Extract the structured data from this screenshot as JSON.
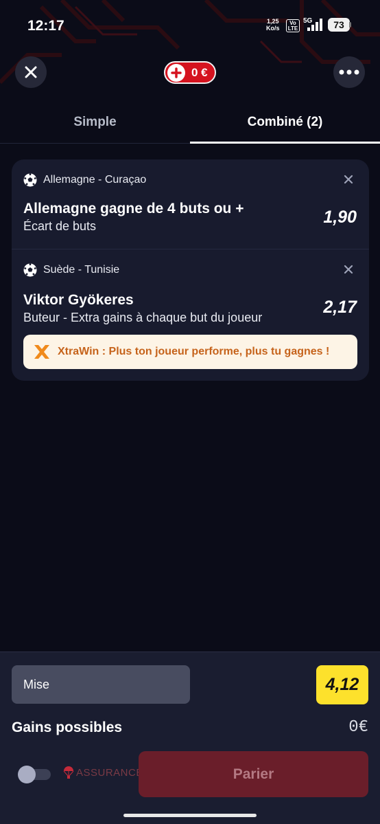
{
  "status_bar": {
    "time": "12:17",
    "net_speed_value": "1,25",
    "net_speed_unit": "Ko/s",
    "volte_top": "Vo",
    "volte_bottom": "LTE",
    "network": "5G",
    "battery": "73"
  },
  "header": {
    "close_icon": "close-icon",
    "balance": "0 €",
    "more_icon": "more-dots-icon"
  },
  "tabs": [
    {
      "label": "Simple",
      "active": false
    },
    {
      "label": "Combiné (2)",
      "active": true
    }
  ],
  "selections": [
    {
      "match": "Allemagne - Curaçao",
      "sport_icon": "soccer-ball-icon",
      "title": "Allemagne gagne de 4 buts ou +",
      "market": "Écart de buts",
      "odds": "1,90"
    },
    {
      "match": "Suède - Tunisie",
      "sport_icon": "soccer-ball-icon",
      "title": "Viktor Gyökeres",
      "market": "Buteur - Extra gains à chaque but du joueur",
      "odds": "2,17",
      "promo": "XtraWin : Plus ton joueur performe, plus tu gagnes !"
    }
  ],
  "betslip": {
    "stake_placeholder": "Mise",
    "total_odds": "4,12",
    "gains_label": "Gains possibles",
    "gains_value": "0€",
    "insurance_label": "ASSURANCE",
    "insurance_enabled": false,
    "bet_button": "Parier"
  },
  "colors": {
    "background": "#0b0c18",
    "card": "#181b2e",
    "brand_red": "#d5131f",
    "odds_yellow": "#fde12c",
    "promo_orange": "#c6631b",
    "bet_button_disabled": "#6a1e2a"
  }
}
